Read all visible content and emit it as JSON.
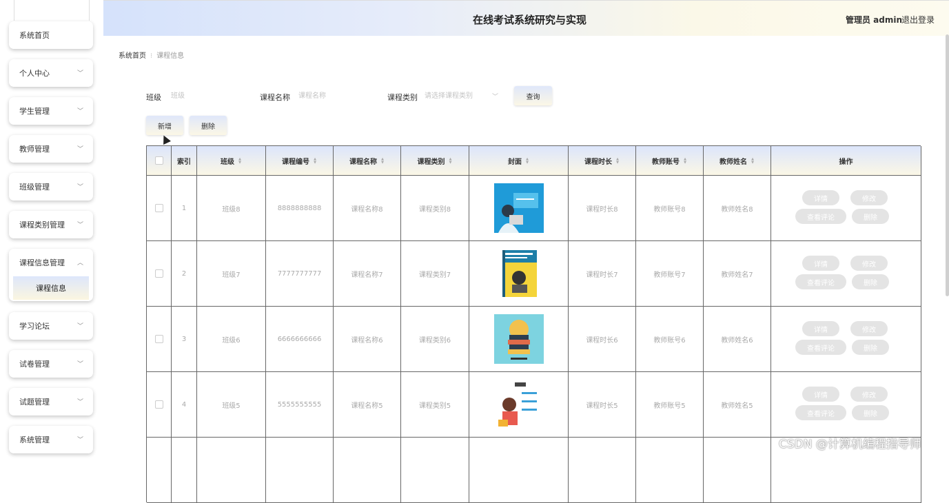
{
  "header": {
    "title": "在线考试系统研究与实现",
    "user": "管理员 admin",
    "logout": "退出登录"
  },
  "sidebar": {
    "items": [
      {
        "label": "系统首页",
        "chevron": false
      },
      {
        "label": "个人中心",
        "chevron": true
      },
      {
        "label": "学生管理",
        "chevron": true
      },
      {
        "label": "教师管理",
        "chevron": true
      },
      {
        "label": "班级管理",
        "chevron": true
      },
      {
        "label": "课程类别管理",
        "chevron": true
      },
      {
        "label": "课程信息管理",
        "chevron": true,
        "open": true,
        "sub": "课程信息"
      },
      {
        "label": "学习论坛",
        "chevron": true
      },
      {
        "label": "试卷管理",
        "chevron": true
      },
      {
        "label": "试题管理",
        "chevron": true
      },
      {
        "label": "系统管理",
        "chevron": true
      }
    ]
  },
  "breadcrumb": {
    "home": "系统首页",
    "current": "课程信息"
  },
  "search": {
    "class_label": "班级",
    "class_placeholder": "班级",
    "course_name_label": "课程名称",
    "course_name_placeholder": "课程名称",
    "category_label": "课程类别",
    "category_placeholder": "请选择课程类别",
    "query_button": "查询"
  },
  "actions": {
    "add": "新增",
    "delete": "删除"
  },
  "table": {
    "headers": [
      "索引",
      "班级",
      "课程编号",
      "课程名称",
      "课程类别",
      "封面",
      "课程时长",
      "教师账号",
      "教师姓名",
      "操作"
    ],
    "rows": [
      {
        "index": "1",
        "class": "班级8",
        "code": "8888888888",
        "name": "课程名称8",
        "category": "课程类别8",
        "cover": "teal-tech",
        "duration": "课程时长8",
        "teacher_account": "教师账号8",
        "teacher_name": "教师姓名8"
      },
      {
        "index": "2",
        "class": "班级7",
        "code": "7777777777",
        "name": "课程名称7",
        "category": "课程类别7",
        "cover": "python-book",
        "duration": "课程时长7",
        "teacher_account": "教师账号7",
        "teacher_name": "教师姓名7"
      },
      {
        "index": "3",
        "class": "班级6",
        "code": "6666666666",
        "name": "课程名称6",
        "category": "课程类别6",
        "cover": "books-stack",
        "duration": "课程时长6",
        "teacher_account": "教师账号6",
        "teacher_name": "教师姓名6"
      },
      {
        "index": "4",
        "class": "班级5",
        "code": "5555555555",
        "name": "课程名称5",
        "category": "课程类别5",
        "cover": "student",
        "duration": "课程时长5",
        "teacher_account": "教师账号5",
        "teacher_name": "教师姓名5"
      }
    ],
    "row_actions": {
      "detail": "详情",
      "edit": "修改",
      "comments": "查看评论",
      "delete": "删除"
    }
  },
  "watermark": "CSDN @计算机编程指导师"
}
